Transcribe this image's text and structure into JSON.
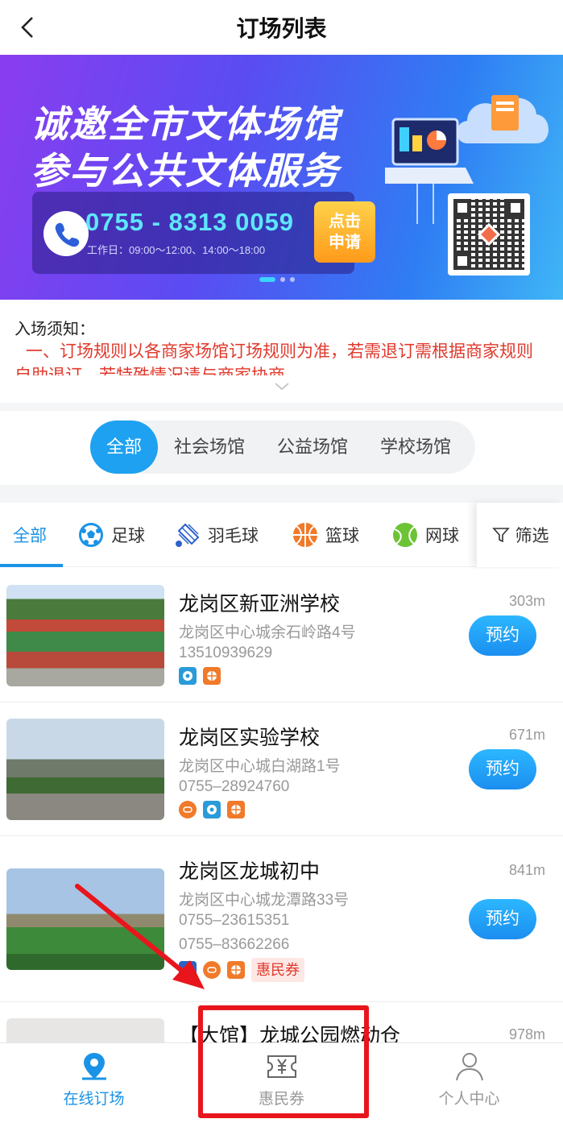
{
  "header": {
    "title": "订场列表"
  },
  "banner": {
    "line1": "诚邀全市文体场馆",
    "line2": "参与公共文体服务",
    "phone": "0755 - 8313 0059",
    "work_hours": "工作日：09:00～12:00、14:00～18:00",
    "apply_label_1": "点击",
    "apply_label_2": "申请"
  },
  "notice": {
    "title": "入场须知：",
    "text": "一、订场规则以各商家场馆订场规则为准，若需退订需根据商家规则自助退订，若特殊情况请与商家协商"
  },
  "venue_types": [
    "全部",
    "社会场馆",
    "公益场馆",
    "学校场馆"
  ],
  "sports": {
    "all": "全部",
    "football": "足球",
    "badminton": "羽毛球",
    "basketball": "篮球",
    "tennis": "网球",
    "filter": "筛选"
  },
  "book_label": "预约",
  "venues": [
    {
      "name": "龙岗区新亚洲学校",
      "address": "龙岗区中心城余石岭路4号",
      "phone1": "13510939629",
      "distance": "303m"
    },
    {
      "name": "龙岗区实验学校",
      "address": "龙岗区中心城白湖路1号",
      "phone1": "0755–28924760",
      "distance": "671m"
    },
    {
      "name": "龙岗区龙城初中",
      "address": "龙岗区中心城龙潭路33号",
      "phone1": "0755–23615351",
      "phone2": "0755–83662266",
      "coupon": "惠民券",
      "distance": "841m"
    },
    {
      "name": "【大馆】龙城公园燃动仓",
      "distance": "978m"
    }
  ],
  "tabbar": {
    "online": "在线订场",
    "coupon": "惠民券",
    "profile": "个人中心"
  },
  "colors": {
    "accent": "#1da1f0",
    "notice_red": "#e0392c",
    "highlight": "#e8161c"
  }
}
